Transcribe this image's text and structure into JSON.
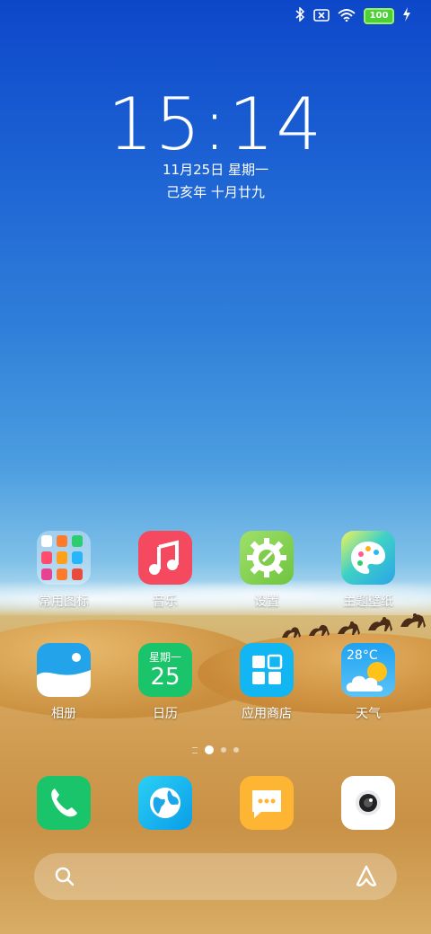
{
  "status_bar": {
    "battery_level": "100",
    "icons": [
      "bluetooth-icon",
      "sim-no-signal-icon",
      "wifi-icon",
      "battery-icon",
      "charging-icon"
    ]
  },
  "clock": {
    "time": "15:14",
    "date": "11月25日 星期一",
    "lunar_date": "己亥年 十月廿九"
  },
  "apps_row1": [
    {
      "label": "常用图标",
      "icon": "folder-icon"
    },
    {
      "label": "音乐",
      "icon": "music-icon",
      "color": "#f5495f"
    },
    {
      "label": "设置",
      "icon": "settings-gear-icon",
      "color": "#8ed65a"
    },
    {
      "label": "主题壁纸",
      "icon": "palette-icon",
      "color": "#36c9cf"
    }
  ],
  "apps_row2": [
    {
      "label": "相册",
      "icon": "gallery-icon",
      "color": "#23a4ea"
    },
    {
      "label": "日历",
      "icon": "calendar-icon",
      "color": "#19c46a",
      "weekday": "星期一",
      "day": "25"
    },
    {
      "label": "应用商店",
      "icon": "app-store-icon",
      "color": "#12b6f2"
    },
    {
      "label": "天气",
      "icon": "weather-icon",
      "color": "#2aa9f3",
      "temperature": "28°C"
    }
  ],
  "page_indicator": {
    "pages": 3,
    "current": 1
  },
  "dock": [
    {
      "icon": "phone-icon",
      "color": "#19c46a"
    },
    {
      "icon": "browser-globe-icon",
      "color": "#17b6ee"
    },
    {
      "icon": "messages-icon",
      "color": "#ffb534"
    },
    {
      "icon": "camera-icon",
      "color": "#ffffff"
    }
  ],
  "search_bar": {
    "icons": [
      "search-icon",
      "assistant-icon"
    ]
  }
}
